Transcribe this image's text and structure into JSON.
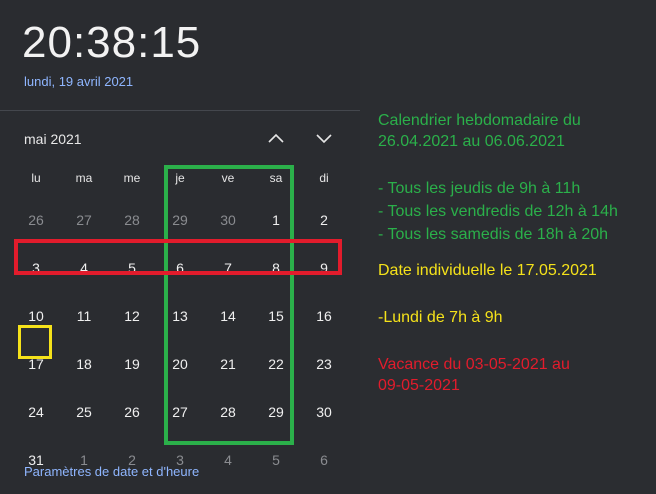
{
  "clock": {
    "time": "20:38:15",
    "date": "lundi, 19 avril 2021"
  },
  "calendar": {
    "month_label": "mai 2021",
    "weekdays": [
      "lu",
      "ma",
      "me",
      "je",
      "ve",
      "sa",
      "di"
    ],
    "weeks": [
      [
        {
          "d": "26",
          "dim": true
        },
        {
          "d": "27",
          "dim": true
        },
        {
          "d": "28",
          "dim": true
        },
        {
          "d": "29",
          "dim": true
        },
        {
          "d": "30",
          "dim": true
        },
        {
          "d": "1",
          "dim": false
        },
        {
          "d": "2",
          "dim": false
        }
      ],
      [
        {
          "d": "3",
          "dim": false
        },
        {
          "d": "4",
          "dim": false
        },
        {
          "d": "5",
          "dim": false
        },
        {
          "d": "6",
          "dim": false
        },
        {
          "d": "7",
          "dim": false
        },
        {
          "d": "8",
          "dim": false
        },
        {
          "d": "9",
          "dim": false
        }
      ],
      [
        {
          "d": "10",
          "dim": false
        },
        {
          "d": "11",
          "dim": false
        },
        {
          "d": "12",
          "dim": false
        },
        {
          "d": "13",
          "dim": false
        },
        {
          "d": "14",
          "dim": false
        },
        {
          "d": "15",
          "dim": false
        },
        {
          "d": "16",
          "dim": false
        }
      ],
      [
        {
          "d": "17",
          "dim": false
        },
        {
          "d": "18",
          "dim": false
        },
        {
          "d": "19",
          "dim": false
        },
        {
          "d": "20",
          "dim": false
        },
        {
          "d": "21",
          "dim": false
        },
        {
          "d": "22",
          "dim": false
        },
        {
          "d": "23",
          "dim": false
        }
      ],
      [
        {
          "d": "24",
          "dim": false
        },
        {
          "d": "25",
          "dim": false
        },
        {
          "d": "26",
          "dim": false
        },
        {
          "d": "27",
          "dim": false
        },
        {
          "d": "28",
          "dim": false
        },
        {
          "d": "29",
          "dim": false
        },
        {
          "d": "30",
          "dim": false
        }
      ],
      [
        {
          "d": "31",
          "dim": false
        },
        {
          "d": "1",
          "dim": true
        },
        {
          "d": "2",
          "dim": true
        },
        {
          "d": "3",
          "dim": true
        },
        {
          "d": "4",
          "dim": true
        },
        {
          "d": "5",
          "dim": true
        },
        {
          "d": "6",
          "dim": true
        }
      ]
    ],
    "settings_link": "Paramètres de date et d'heure"
  },
  "icons": {
    "prev": "chevron-up-icon",
    "next": "chevron-down-icon"
  },
  "colors": {
    "green": "#2bb04a",
    "yellow": "#f5e21a",
    "red": "#e21c2c",
    "link": "#8fb6ff"
  },
  "notes": {
    "green_line1": "Calendrier hebdomadaire du",
    "green_line2": "26.04.2021 au 06.06.2021",
    "green_item1": "- Tous les jeudis de 9h à 11h",
    "green_item2": "- Tous les vendredis de 12h à 14h",
    "green_item3": "- Tous les samedis de 18h à 20h",
    "yellow_line1": "Date individuelle le 17.05.2021",
    "yellow_line2": "-Lundi de 7h à 9h",
    "red_line1": "Vacance du 03-05-2021 au",
    "red_line2": "09-05-2021"
  }
}
